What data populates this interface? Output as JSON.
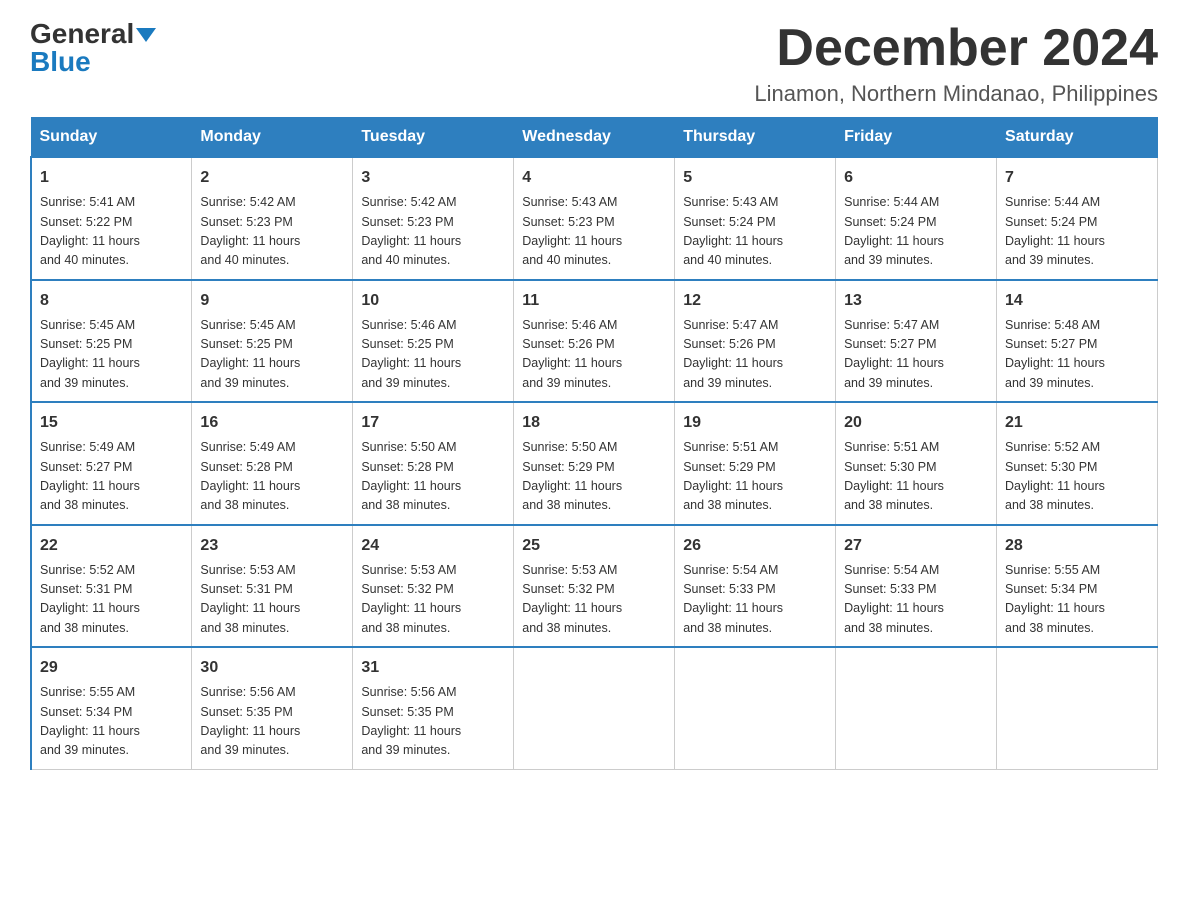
{
  "header": {
    "logo_general": "General",
    "logo_blue": "Blue",
    "month_title": "December 2024",
    "location": "Linamon, Northern Mindanao, Philippines"
  },
  "days_of_week": [
    "Sunday",
    "Monday",
    "Tuesday",
    "Wednesday",
    "Thursday",
    "Friday",
    "Saturday"
  ],
  "weeks": [
    [
      {
        "day": "1",
        "sunrise": "5:41 AM",
        "sunset": "5:22 PM",
        "daylight": "11 hours and 40 minutes."
      },
      {
        "day": "2",
        "sunrise": "5:42 AM",
        "sunset": "5:23 PM",
        "daylight": "11 hours and 40 minutes."
      },
      {
        "day": "3",
        "sunrise": "5:42 AM",
        "sunset": "5:23 PM",
        "daylight": "11 hours and 40 minutes."
      },
      {
        "day": "4",
        "sunrise": "5:43 AM",
        "sunset": "5:23 PM",
        "daylight": "11 hours and 40 minutes."
      },
      {
        "day": "5",
        "sunrise": "5:43 AM",
        "sunset": "5:24 PM",
        "daylight": "11 hours and 40 minutes."
      },
      {
        "day": "6",
        "sunrise": "5:44 AM",
        "sunset": "5:24 PM",
        "daylight": "11 hours and 39 minutes."
      },
      {
        "day": "7",
        "sunrise": "5:44 AM",
        "sunset": "5:24 PM",
        "daylight": "11 hours and 39 minutes."
      }
    ],
    [
      {
        "day": "8",
        "sunrise": "5:45 AM",
        "sunset": "5:25 PM",
        "daylight": "11 hours and 39 minutes."
      },
      {
        "day": "9",
        "sunrise": "5:45 AM",
        "sunset": "5:25 PM",
        "daylight": "11 hours and 39 minutes."
      },
      {
        "day": "10",
        "sunrise": "5:46 AM",
        "sunset": "5:25 PM",
        "daylight": "11 hours and 39 minutes."
      },
      {
        "day": "11",
        "sunrise": "5:46 AM",
        "sunset": "5:26 PM",
        "daylight": "11 hours and 39 minutes."
      },
      {
        "day": "12",
        "sunrise": "5:47 AM",
        "sunset": "5:26 PM",
        "daylight": "11 hours and 39 minutes."
      },
      {
        "day": "13",
        "sunrise": "5:47 AM",
        "sunset": "5:27 PM",
        "daylight": "11 hours and 39 minutes."
      },
      {
        "day": "14",
        "sunrise": "5:48 AM",
        "sunset": "5:27 PM",
        "daylight": "11 hours and 39 minutes."
      }
    ],
    [
      {
        "day": "15",
        "sunrise": "5:49 AM",
        "sunset": "5:27 PM",
        "daylight": "11 hours and 38 minutes."
      },
      {
        "day": "16",
        "sunrise": "5:49 AM",
        "sunset": "5:28 PM",
        "daylight": "11 hours and 38 minutes."
      },
      {
        "day": "17",
        "sunrise": "5:50 AM",
        "sunset": "5:28 PM",
        "daylight": "11 hours and 38 minutes."
      },
      {
        "day": "18",
        "sunrise": "5:50 AM",
        "sunset": "5:29 PM",
        "daylight": "11 hours and 38 minutes."
      },
      {
        "day": "19",
        "sunrise": "5:51 AM",
        "sunset": "5:29 PM",
        "daylight": "11 hours and 38 minutes."
      },
      {
        "day": "20",
        "sunrise": "5:51 AM",
        "sunset": "5:30 PM",
        "daylight": "11 hours and 38 minutes."
      },
      {
        "day": "21",
        "sunrise": "5:52 AM",
        "sunset": "5:30 PM",
        "daylight": "11 hours and 38 minutes."
      }
    ],
    [
      {
        "day": "22",
        "sunrise": "5:52 AM",
        "sunset": "5:31 PM",
        "daylight": "11 hours and 38 minutes."
      },
      {
        "day": "23",
        "sunrise": "5:53 AM",
        "sunset": "5:31 PM",
        "daylight": "11 hours and 38 minutes."
      },
      {
        "day": "24",
        "sunrise": "5:53 AM",
        "sunset": "5:32 PM",
        "daylight": "11 hours and 38 minutes."
      },
      {
        "day": "25",
        "sunrise": "5:53 AM",
        "sunset": "5:32 PM",
        "daylight": "11 hours and 38 minutes."
      },
      {
        "day": "26",
        "sunrise": "5:54 AM",
        "sunset": "5:33 PM",
        "daylight": "11 hours and 38 minutes."
      },
      {
        "day": "27",
        "sunrise": "5:54 AM",
        "sunset": "5:33 PM",
        "daylight": "11 hours and 38 minutes."
      },
      {
        "day": "28",
        "sunrise": "5:55 AM",
        "sunset": "5:34 PM",
        "daylight": "11 hours and 38 minutes."
      }
    ],
    [
      {
        "day": "29",
        "sunrise": "5:55 AM",
        "sunset": "5:34 PM",
        "daylight": "11 hours and 39 minutes."
      },
      {
        "day": "30",
        "sunrise": "5:56 AM",
        "sunset": "5:35 PM",
        "daylight": "11 hours and 39 minutes."
      },
      {
        "day": "31",
        "sunrise": "5:56 AM",
        "sunset": "5:35 PM",
        "daylight": "11 hours and 39 minutes."
      },
      null,
      null,
      null,
      null
    ]
  ],
  "labels": {
    "sunrise": "Sunrise:",
    "sunset": "Sunset:",
    "daylight": "Daylight:"
  }
}
